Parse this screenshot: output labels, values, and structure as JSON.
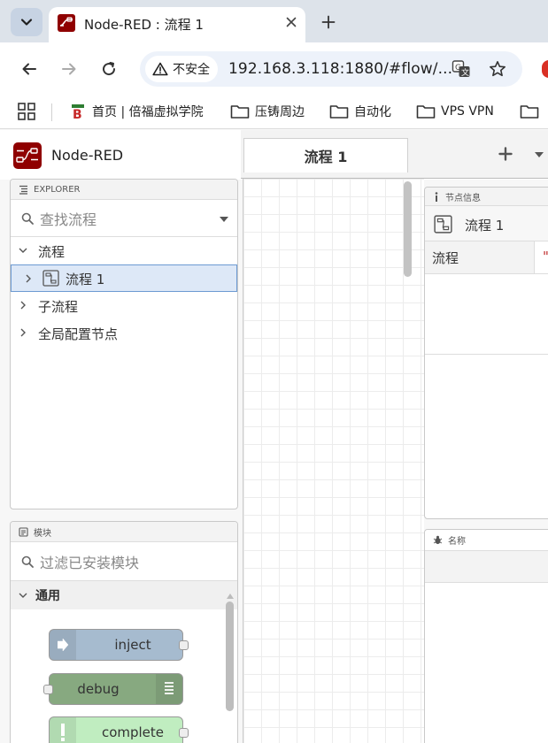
{
  "browser": {
    "tab": {
      "title": "Node-RED : 流程 1"
    },
    "address_bar": {
      "security_label": "不安全",
      "url": "192.168.3.118:1880/#flow/..."
    },
    "bookmarks": [
      {
        "label": "首页 | 倍福虚拟学院"
      },
      {
        "label": "压铸周边"
      },
      {
        "label": "自动化"
      },
      {
        "label": "VPS VPN"
      }
    ]
  },
  "nodered": {
    "title": "Node-RED",
    "workspace": {
      "tabs": [
        {
          "label": "流程 1"
        }
      ]
    },
    "explorer": {
      "header": "EXPLORER",
      "search_placeholder": "查找流程",
      "tree": {
        "root": "流程",
        "flows": [
          {
            "label": "流程 1"
          }
        ],
        "subflows": "子流程",
        "global_config": "全局配置节点"
      }
    },
    "palette": {
      "header": "模块",
      "filter_placeholder": "过滤已安装模块",
      "category": "通用",
      "nodes": [
        {
          "label": "inject",
          "color": "#a6bbcf"
        },
        {
          "label": "debug",
          "color": "#87a980"
        },
        {
          "label": "complete",
          "color": "#c0edc0"
        }
      ]
    },
    "info_panel": {
      "header": "节点信息",
      "flow_title": "流程 1",
      "rows": [
        {
          "label": "流程",
          "value": "\""
        }
      ]
    },
    "help_panel": {
      "header": "名称"
    }
  },
  "colors": {
    "brand": "#8f0000",
    "selection_bg": "#dde8f7",
    "selection_border": "#6c9ad2"
  }
}
